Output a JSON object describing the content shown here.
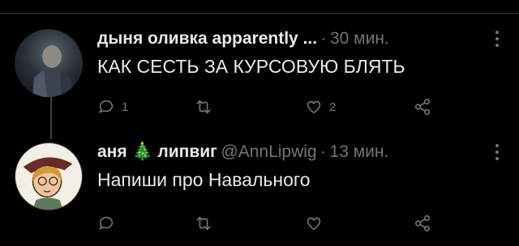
{
  "tweets": [
    {
      "name": "дыня оливка apparently ...",
      "time": "30 мин.",
      "text": "КАК СЕСТЬ ЗА КУРСОВУЮ БЛЯТЬ",
      "replies": "1",
      "retweets": "",
      "likes": "2"
    },
    {
      "name": "аня 🎄 липвиг",
      "handle": "@AnnLipwig",
      "time": "13 мин.",
      "text": "Напиши про Навального",
      "replies": "",
      "retweets": "",
      "likes": ""
    }
  ],
  "separator": "·",
  "colors": {
    "background": "#000000",
    "text": "#e7e9ea",
    "muted": "#71767b"
  },
  "icons": [
    "reply-icon",
    "retweet-icon",
    "like-icon",
    "share-icon",
    "more-icon"
  ]
}
